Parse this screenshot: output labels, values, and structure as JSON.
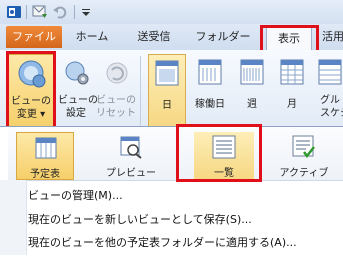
{
  "tabs": {
    "file": "ファイル",
    "home": "ホーム",
    "send_receive": "送受信",
    "folder": "フォルダー",
    "view": "表示",
    "more": "活用"
  },
  "ribbon": {
    "change_view": "ビューの\n変更 ▾",
    "view_settings": "ビューの\n設定",
    "reset_view": "ビューの\nリセット",
    "day": "日",
    "work_week": "稼働日",
    "week": "週",
    "month": "月",
    "schedule": "グル\nスケジ"
  },
  "views": {
    "calendar": "予定表",
    "preview": "プレビュー",
    "list": "一覧",
    "active": "アクティブ"
  },
  "menu": {
    "manage": "ビューの管理(M)...",
    "save_as_new": "現在のビューを新しいビューとして保存(S)...",
    "apply_to_other": "現在のビューを他の予定表フォルダーに適用する(A)..."
  },
  "colors": {
    "file_tab": "#d4661b",
    "highlight": "#e0101a",
    "selected": "#f8d98a"
  }
}
